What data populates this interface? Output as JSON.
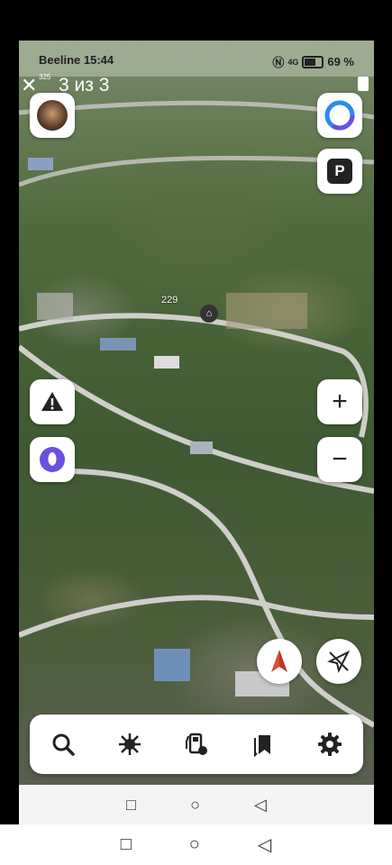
{
  "status": {
    "carrier": "Beeline",
    "time": "15:44",
    "network": "4G",
    "battery": "69 %"
  },
  "viewer": {
    "counter": "3 из 3",
    "badge": "325"
  },
  "map": {
    "house_number": "229"
  },
  "icons": {
    "close": "close-icon",
    "trash": "trash-icon",
    "alice": "alice-icon",
    "parking": "parking-icon",
    "warning": "warning-icon",
    "zoom_in": "plus-icon",
    "zoom_out": "minus-icon",
    "compass": "compass-icon",
    "location": "location-off-icon",
    "search": "search-icon",
    "layers": "layers-icon",
    "gas": "gas-station-icon",
    "bookmarks": "bookmarks-icon",
    "settings": "gear-icon"
  },
  "system_nav": {
    "square": "□",
    "circle": "○",
    "back": "◁"
  },
  "colors": {
    "alice_purple": "#6b4fe0",
    "alice_blue": "#2a8bf2",
    "compass_red": "#e24a34"
  }
}
